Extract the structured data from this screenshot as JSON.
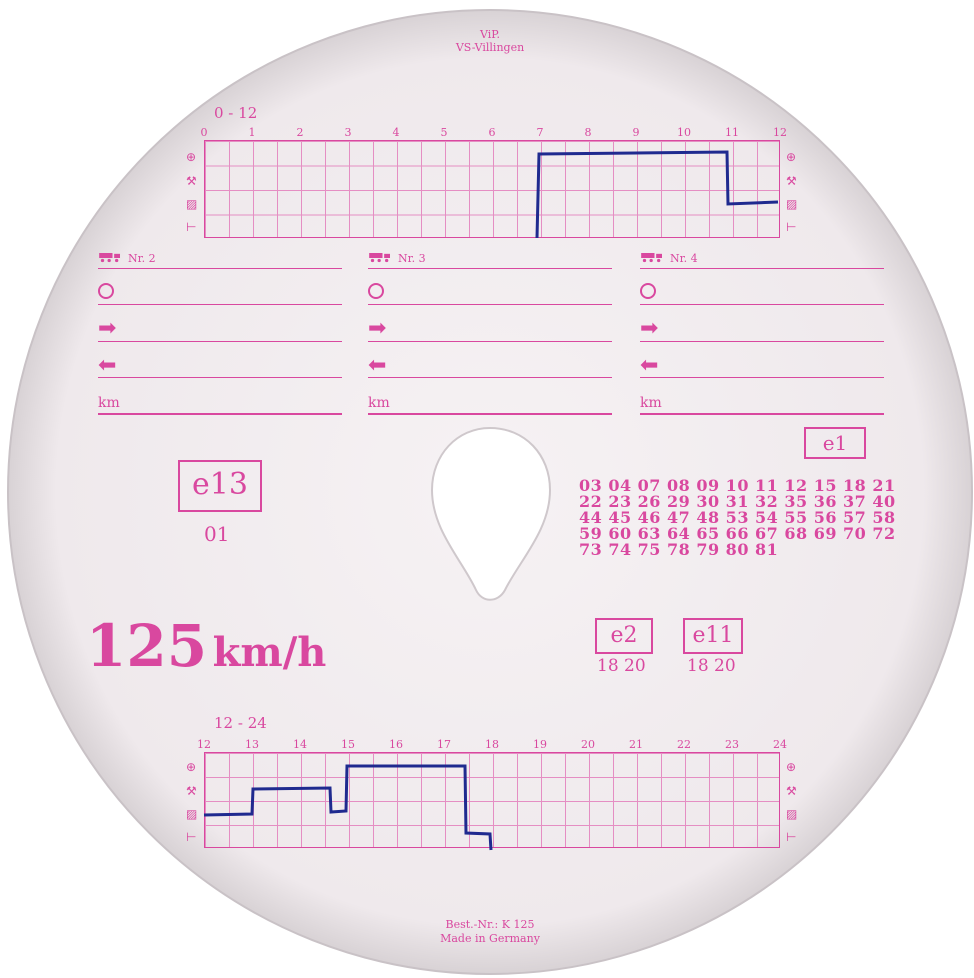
{
  "header": {
    "line1": "ViP.",
    "line2": "VS-Villingen"
  },
  "top_chart": {
    "range_label": "0 - 12",
    "hour_labels": [
      "0",
      "1",
      "2",
      "3",
      "4",
      "5",
      "6",
      "7",
      "8",
      "9",
      "10",
      "11",
      "12"
    ]
  },
  "bottom_chart": {
    "range_label": "12 - 24",
    "hour_labels": [
      "12",
      "13",
      "14",
      "15",
      "16",
      "17",
      "18",
      "19",
      "20",
      "21",
      "22",
      "23",
      "24"
    ]
  },
  "vehicle_blocks": [
    {
      "nr": "Nr. 2",
      "km_label": "km"
    },
    {
      "nr": "Nr. 3",
      "km_label": "km"
    },
    {
      "nr": "Nr. 4",
      "km_label": "km"
    }
  ],
  "approvals": {
    "e13": {
      "label": "e13",
      "sub": "01"
    },
    "e1": {
      "label": "e1"
    },
    "e2": {
      "label": "e2",
      "sub": "18 20"
    },
    "e11": {
      "label": "e11",
      "sub": "18 20"
    },
    "code_lines": [
      "03 04 07 08 09 10 11 12 15 18 21",
      "22 23 26 29 30 31 32 35 36 37 40",
      "44 45 46 47 48 53 54 55 56 57 58",
      "59 60 63 64 65 66 67 68 69 70 72",
      "73 74 75 78 79 80 81"
    ]
  },
  "speed": {
    "value": "125",
    "unit": "km/h"
  },
  "footer": {
    "line1": "Best.-Nr.: K 125",
    "line2": "Made in Germany"
  },
  "colors": {
    "print": "#d9489f",
    "grid": "#e58ec3",
    "ink": "#1f2a8f",
    "paper": "#f3eff1"
  },
  "icons": [
    "steering-wheel-icon",
    "hammers-icon",
    "rest-box-icon",
    "bed-icon",
    "truck-icon",
    "clock-icon",
    "arrow-right-icon",
    "arrow-left-icon"
  ]
}
